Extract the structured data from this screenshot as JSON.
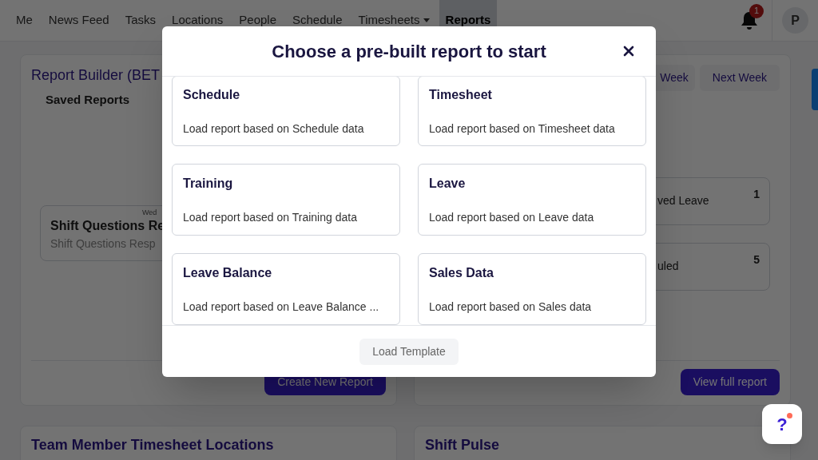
{
  "nav": {
    "items": [
      {
        "label": "Me",
        "selected": false,
        "has_menu": false
      },
      {
        "label": "News Feed",
        "selected": false,
        "has_menu": false
      },
      {
        "label": "Tasks",
        "selected": false,
        "has_menu": false
      },
      {
        "label": "Locations",
        "selected": false,
        "has_menu": false
      },
      {
        "label": "People",
        "selected": false,
        "has_menu": false
      },
      {
        "label": "Schedule",
        "selected": false,
        "has_menu": false
      },
      {
        "label": "Timesheets",
        "selected": false,
        "has_menu": true
      },
      {
        "label": "Reports",
        "selected": true,
        "has_menu": false
      }
    ],
    "notification_count": "1",
    "avatar": "P"
  },
  "report_builder": {
    "title": "Report Builder (BET",
    "section": "Saved Reports",
    "saved": [
      {
        "date": "Wed",
        "title": "Shift Questions Re",
        "subtitle": "Shift Questions Resp"
      }
    ],
    "button": "Create New Report"
  },
  "summary": {
    "buttons": [
      "Week",
      "Next Week"
    ],
    "rows": [
      {
        "label": "ved Leave",
        "count": "1"
      },
      {
        "label": "uled",
        "count": "5"
      }
    ],
    "button": "View full report"
  },
  "bottom_cards": [
    "Team Member Timesheet Locations",
    "Shift Pulse"
  ],
  "modal": {
    "title": "Choose a pre-built report to start",
    "templates": [
      {
        "name": "Schedule",
        "description": "Load report based on Schedule data"
      },
      {
        "name": "Timesheet",
        "description": "Load report based on Timesheet data"
      },
      {
        "name": "Training",
        "description": "Load report based on Training data"
      },
      {
        "name": "Leave",
        "description": "Load report based on Leave data"
      },
      {
        "name": "Leave Balance",
        "description": "Load report based on Leave Balance ..."
      },
      {
        "name": "Sales Data",
        "description": "Load report based on Sales data"
      }
    ],
    "button": "Load Template"
  },
  "help_button": "?"
}
